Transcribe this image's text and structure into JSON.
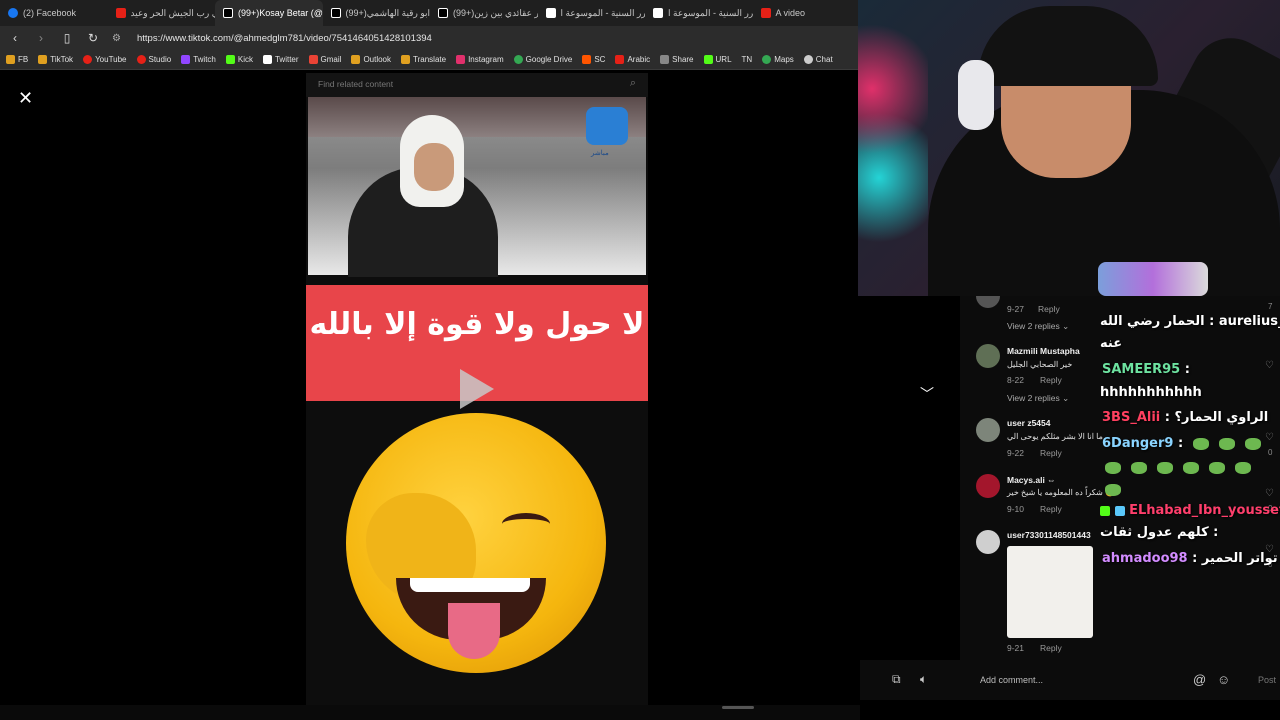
{
  "tabs": [
    {
      "title": "(2) Facebook",
      "icon_color": "#1877f2",
      "active": false
    },
    {
      "title": "عيني رب الجيش الحر وعيد...",
      "icon_color": "#e62117",
      "active": false
    },
    {
      "title": "(99+)Kosay Betar (@...",
      "icon_color": "#ffffff",
      "active": true
    },
    {
      "title": "(99+)ابو رقية الهاشمي (@",
      "icon_color": "#ffffff",
      "active": false
    },
    {
      "title": "(99+)حوار عقائدي بين زين...",
      "icon_color": "#ffffff",
      "active": false
    },
    {
      "title": "الدرر السنية - الموسوعة ا...",
      "icon_color": "#ffffff",
      "active": false
    },
    {
      "title": "الدرر السنية - الموسوعة ا...",
      "icon_color": "#ffffff",
      "active": false
    },
    {
      "title": "A video",
      "icon_color": "#e62117",
      "active": false
    }
  ],
  "address": {
    "url": "https://www.tiktok.com/@ahmedglm781/video/7541464051428101394"
  },
  "bookmarks": [
    {
      "label": "FB",
      "color": "#e0a020"
    },
    {
      "label": "TikTok",
      "color": "#e0a020"
    },
    {
      "label": "YouTube",
      "color": "#e62117"
    },
    {
      "label": "Studio",
      "color": "#e62117"
    },
    {
      "label": "Twitch",
      "color": "#9146ff"
    },
    {
      "label": "Kick",
      "color": "#53fc18"
    },
    {
      "label": "Twitter",
      "color": "#ffffff"
    },
    {
      "label": "Gmail",
      "color": "#ea4335"
    },
    {
      "label": "Outlook",
      "color": "#e0a020"
    },
    {
      "label": "Translate",
      "color": "#e0a020"
    },
    {
      "label": "Instagram",
      "color": "#e1306c"
    },
    {
      "label": "Google Drive",
      "color": "#34a853"
    },
    {
      "label": "SC",
      "color": "#ff5500"
    },
    {
      "label": "Arabic",
      "color": "#e62117"
    },
    {
      "label": "Share",
      "color": "#888888"
    },
    {
      "label": "URL",
      "color": "#53fc18"
    },
    {
      "label": "TN",
      "color": "#888888"
    },
    {
      "label": "Maps",
      "color": "#34a853"
    },
    {
      "label": "Chat",
      "color": "#cccccc"
    }
  ],
  "video": {
    "search_placeholder": "Find related content",
    "banner_text": "لا حول ولا قوة إلا بالله",
    "logo_caption": "مباشر"
  },
  "comments": [
    {
      "user": "",
      "text": "",
      "date": "9-27",
      "reply": "Reply",
      "view_replies": "View 2 replies ⌄",
      "likes": "7"
    },
    {
      "user": "Mazmili Mustapha",
      "text": "خير الصحابي الجليل",
      "date": "8-22",
      "reply": "Reply",
      "view_replies": "View 2 replies ⌄",
      "likes": ""
    },
    {
      "user": "user z5454",
      "text": "ما انا الا بشر مثلكم يوحى الي",
      "date": "9-22",
      "reply": "Reply",
      "likes": "0"
    },
    {
      "user": "Macys.ali ⇔",
      "text": "شكراً ده المعلومه يا شيخ خير 😀",
      "date": "9-10",
      "reply": "Reply",
      "likes": "0"
    },
    {
      "user": "user73301148501443",
      "text": "",
      "date": "9-21",
      "reply": "Reply",
      "likes": "0"
    }
  ],
  "chat": [
    {
      "user": "aurelius_1",
      "message": "الحمار رضي الله",
      "message2": "عنه",
      "user_color": "#ffffff"
    },
    {
      "user": "SAMEER95",
      "message": "hhhhhhhhhhh",
      "user_color": "#6de2a0"
    },
    {
      "user": "3BS_Alii",
      "message": "الراوي الحمار؟",
      "user_color": "#ff4060"
    },
    {
      "user": "6Danger9",
      "message": "",
      "user_color": "#8ad4ff"
    },
    {
      "user": "ELhabad_Ibn_youssef",
      "message": "كلهم عدول ثقات",
      "user_color": "#ff3f6c"
    },
    {
      "user": "ahmadoo98",
      "message": "تواتر الحمير",
      "user_color": "#d28cff"
    }
  ],
  "footer": {
    "add_comment_placeholder": "Add comment...",
    "post_label": "Post"
  }
}
